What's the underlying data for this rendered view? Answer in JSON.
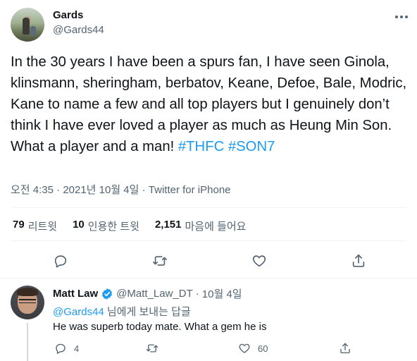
{
  "tweet": {
    "author_name": "Gards",
    "author_handle": "@Gards44",
    "text_main": "In the 30 years I have been a spurs fan, I have seen Ginola, klinsmann, sheringham, berbatov, Keane, Defoe, Bale, Modric, Kane to name a few and all top players but I genuinely don’t think I have ever loved a player as much as Heung Min Son. What a player and a man! ",
    "hashtag_1": "#THFC",
    "hashtag_2": "#SON7",
    "time": "오전 4:35",
    "separator": "·",
    "date": "2021년 10월 4일",
    "source": "Twitter for iPhone",
    "stats": {
      "retweets_count": "79",
      "retweets_label": "리트윗",
      "quotes_count": "10",
      "quotes_label": "인용한 트윗",
      "likes_count": "2,151",
      "likes_label": "마음에 들어요"
    }
  },
  "reply": {
    "author_name": "Matt Law",
    "author_handle": "@Matt_Law_DT",
    "separator": "·",
    "date": "10월 4일",
    "replying_to_handle": "@Gards44",
    "replying_to_suffix": " 님에게 보내는 답글",
    "text": "He was superb today mate. What a gem he is",
    "reply_count": "4",
    "like_count": "60"
  },
  "icons": {
    "more": "more-dots-icon",
    "reply": "reply-icon",
    "retweet": "retweet-icon",
    "like": "heart-icon",
    "share": "share-icon",
    "verified": "verified-badge-icon"
  },
  "colors": {
    "accent": "#1d9bf0",
    "secondary_text": "#536471",
    "primary_text": "#0f1419",
    "divider": "#eff3f4"
  }
}
